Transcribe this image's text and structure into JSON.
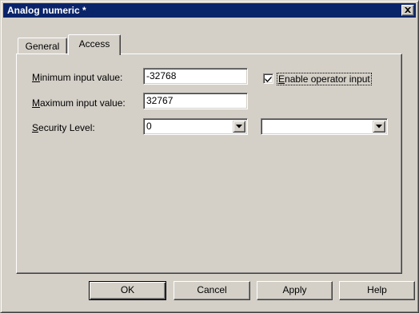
{
  "window": {
    "title": "Analog numeric *",
    "close_icon": "close-icon"
  },
  "tabs": [
    {
      "label": "General",
      "selected": false
    },
    {
      "label": "Access",
      "selected": true
    }
  ],
  "form": {
    "min_label_ul": "M",
    "min_label_rest": "inimum input value:",
    "min_value": "-32768",
    "max_label_ul": "M",
    "max_label_rest": "aximum input value:",
    "max_value": "32767",
    "security_label_ul": "S",
    "security_label_rest": "ecurity Level:",
    "security_value": "0",
    "secondary_combo_value": "",
    "enable_checkbox": {
      "checked": true,
      "label_ul": "E",
      "label_rest": "nable operator input"
    }
  },
  "buttons": {
    "ok": "OK",
    "cancel": "Cancel",
    "apply": "Apply",
    "help": "Help"
  }
}
